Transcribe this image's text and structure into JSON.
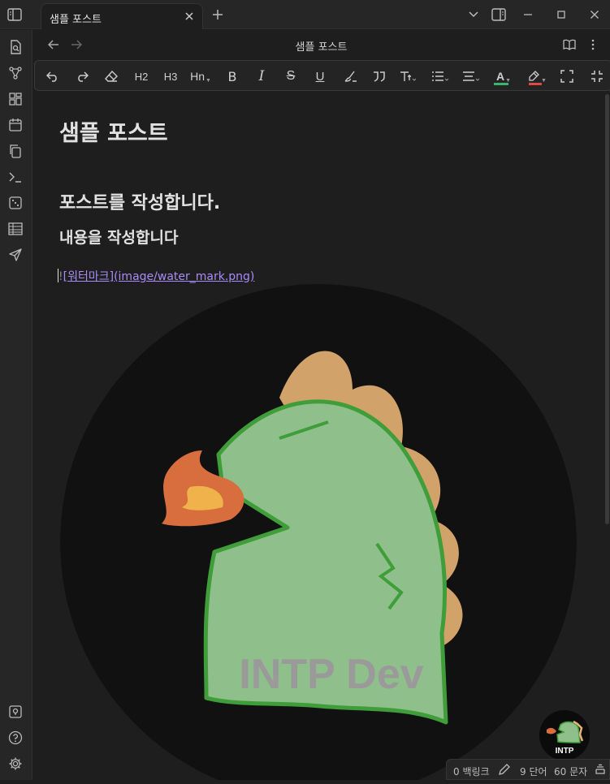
{
  "tab": {
    "title": "샘플 포스트"
  },
  "view": {
    "title": "샘플 포스트"
  },
  "toolbar": {
    "h2": "H2",
    "h3": "H3",
    "hn": "Hn",
    "bold": "B",
    "italic": "I",
    "strike": "S",
    "underline": "U",
    "font_color": "A"
  },
  "document": {
    "h1": "샘플 포스트",
    "h2": "포스트를 작성합니다.",
    "h3": "내용을 작성합니다",
    "link": {
      "bang": "!",
      "text": "[워터마크]",
      "url": "(image/water_mark.png)"
    }
  },
  "watermark": {
    "caption": "INTP Dev"
  },
  "avatar": {
    "caption": "INTP"
  },
  "status": {
    "backlinks": "0 백링크",
    "words": "9 단어",
    "chars": "60 문자"
  },
  "colors": {
    "accent": "#a88bfa",
    "font_color_underline": "#3cb371",
    "highlight_underline": "#e04848"
  }
}
